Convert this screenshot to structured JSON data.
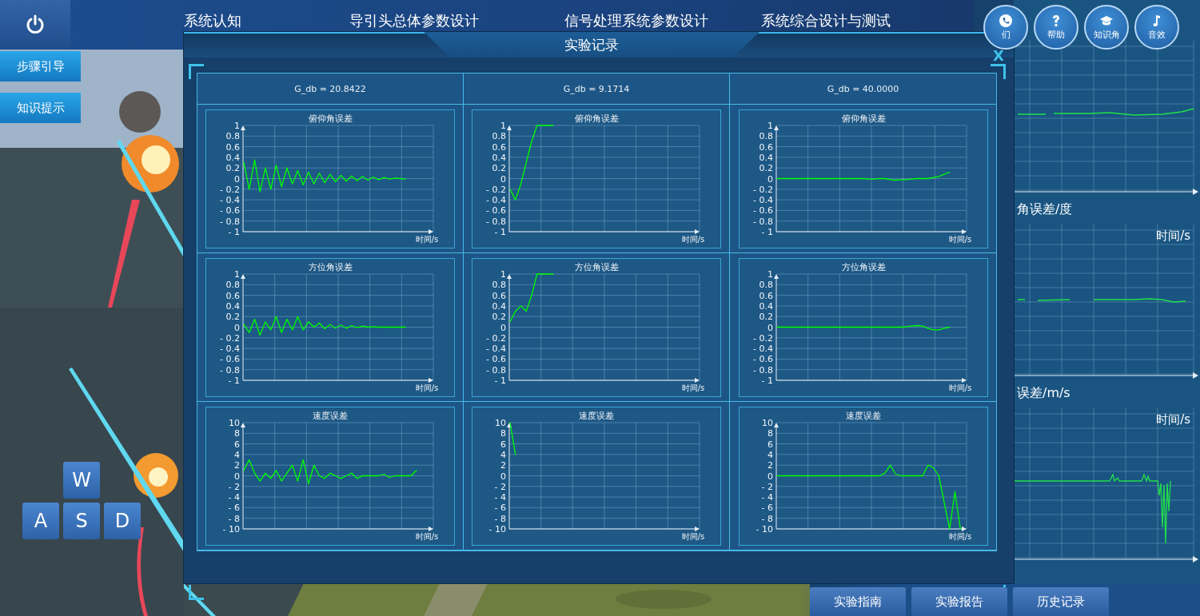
{
  "top_nav": {
    "tabs": [
      {
        "label": "系统认知"
      },
      {
        "label": "导引头总体参数设计"
      },
      {
        "label": "信号处理系统参数设计"
      },
      {
        "label": "系统综合设计与测试"
      }
    ]
  },
  "side_buttons": [
    "步骤引导",
    "知识提示"
  ],
  "keys": [
    "W",
    "A",
    "S",
    "D"
  ],
  "tool_buttons": [
    {
      "kind": "phone",
      "label": "们"
    },
    {
      "kind": "help",
      "label": "帮助"
    },
    {
      "kind": "cap",
      "label": "知识角"
    },
    {
      "kind": "note",
      "label": "音效"
    }
  ],
  "background_charts": [
    {
      "kind": "rise"
    },
    {
      "kind": "dip",
      "caption": "角误差/度",
      "xlabel": "时间/s"
    },
    {
      "kind": "spikes",
      "caption": "误差/m/s",
      "xlabel": "时间/s"
    }
  ],
  "dialog": {
    "title": "实验记录",
    "close": "X",
    "columns": [
      "G_db = 20.8422",
      "G_db = 9.1714",
      "G_db = 40.0000"
    ],
    "rows": [
      [
        {
          "chart_data": {
            "type": "line",
            "title": "俯仰角误差",
            "xlabel": "时间/s",
            "grid": true,
            "ylim": [
              -1,
              1
            ],
            "yticks": [
              1,
              {
                "value": 0.8,
                "label": "0.8"
              },
              {
                "value": 0.6,
                "label": "0.6"
              },
              {
                "value": 0.4,
                "label": "0.4"
              },
              {
                "value": 0.2,
                "label": "0.2"
              },
              0,
              {
                "value": -0.2,
                "label": "- 0.2"
              },
              {
                "value": -0.4,
                "label": "- 0.4"
              },
              {
                "value": -0.6,
                "label": "- 0.6"
              },
              {
                "value": -0.8,
                "label": "- 0.8"
              },
              {
                "value": -1,
                "label": "- 1"
              }
            ],
            "series": [
              {
                "color": "#00ff00",
                "values": [
                  0.3,
                  -0.2,
                  0.35,
                  -0.25,
                  0.2,
                  -0.2,
                  0.25,
                  -0.15,
                  0.2,
                  -0.1,
                  0.15,
                  -0.12,
                  0.12,
                  -0.1,
                  0.1,
                  -0.08,
                  0.08,
                  -0.06,
                  0.06,
                  -0.05,
                  0.05,
                  -0.04,
                  0.04,
                  -0.03,
                  0.03,
                  -0.02,
                  0.02,
                  -0.01,
                  0.01,
                  0,
                  -0.01,
                  null,
                  null,
                  null,
                  null,
                  null
                ]
              }
            ]
          }
        },
        {
          "chart_data": {
            "type": "line",
            "title": "俯仰角误差",
            "xlabel": "时间/s",
            "grid": true,
            "ylim": [
              -1,
              1
            ],
            "yticks": [
              1,
              {
                "value": 0.8,
                "label": "0.8"
              },
              {
                "value": 0.6,
                "label": "0.6"
              },
              {
                "value": 0.4,
                "label": "0.4"
              },
              {
                "value": 0.2,
                "label": "0.2"
              },
              0,
              {
                "value": -0.2,
                "label": "- 0.2"
              },
              {
                "value": -0.4,
                "label": "- 0.4"
              },
              {
                "value": -0.6,
                "label": "- 0.6"
              },
              {
                "value": -0.8,
                "label": "- 0.8"
              },
              {
                "value": -1,
                "label": "- 1"
              }
            ],
            "series": [
              {
                "color": "#00ff00",
                "values": [
                  -0.2,
                  -0.4,
                  -0.1,
                  0.3,
                  0.7,
                  1,
                  1,
                  1,
                  1,
                  null,
                  null,
                  null,
                  null,
                  null,
                  null,
                  null,
                  null,
                  null,
                  null,
                  null,
                  null,
                  null,
                  null,
                  null,
                  null,
                  null,
                  null,
                  null,
                  null,
                  null,
                  null,
                  null,
                  null,
                  null,
                  null,
                  null
                ]
              }
            ]
          }
        },
        {
          "chart_data": {
            "type": "line",
            "title": "俯仰角误差",
            "xlabel": "时间/s",
            "grid": true,
            "ylim": [
              -1,
              1
            ],
            "yticks": [
              1,
              {
                "value": 0.8,
                "label": "0.8"
              },
              {
                "value": 0.6,
                "label": "0.6"
              },
              {
                "value": 0.4,
                "label": "0.4"
              },
              {
                "value": 0.2,
                "label": "0.2"
              },
              0,
              {
                "value": -0.2,
                "label": "- 0.2"
              },
              {
                "value": -0.4,
                "label": "- 0.4"
              },
              {
                "value": -0.6,
                "label": "- 0.6"
              },
              {
                "value": -0.8,
                "label": "- 0.8"
              },
              {
                "value": -1,
                "label": "- 1"
              }
            ],
            "series": [
              {
                "color": "#00ff00",
                "values": [
                  0,
                  0,
                  0,
                  0,
                  0,
                  0,
                  0,
                  0,
                  0,
                  0,
                  0,
                  0,
                  0,
                  0,
                  0,
                  0,
                  0,
                  -0.01,
                  -0.01,
                  0,
                  0,
                  -0.02,
                  -0.03,
                  -0.02,
                  -0.02,
                  -0.01,
                  0,
                  0,
                  0,
                  0.02,
                  0.04,
                  0.08,
                  0.12,
                  null,
                  null,
                  null
                ]
              }
            ]
          }
        }
      ],
      [
        {
          "chart_data": {
            "type": "line",
            "title": "方位角误差",
            "xlabel": "时间/s",
            "grid": true,
            "ylim": [
              -1,
              1
            ],
            "yticks": [
              1,
              {
                "value": 0.8,
                "label": "0.8"
              },
              {
                "value": 0.6,
                "label": "0.6"
              },
              {
                "value": 0.4,
                "label": "0.4"
              },
              {
                "value": 0.2,
                "label": "0.2"
              },
              0,
              {
                "value": -0.2,
                "label": "- 0.2"
              },
              {
                "value": -0.4,
                "label": "- 0.4"
              },
              {
                "value": -0.6,
                "label": "- 0.6"
              },
              {
                "value": -0.8,
                "label": "- 0.8"
              },
              {
                "value": -1,
                "label": "- 1"
              }
            ],
            "series": [
              {
                "color": "#00ff00",
                "values": [
                  0.05,
                  -0.1,
                  0.15,
                  -0.15,
                  0.1,
                  -0.05,
                  0.2,
                  -0.1,
                  0.15,
                  -0.05,
                  0.2,
                  -0.05,
                  0.1,
                  0,
                  0.08,
                  -0.03,
                  0.05,
                  -0.02,
                  0.04,
                  -0.02,
                  0.03,
                  -0.01,
                  0.02,
                  0,
                  0.01,
                  0,
                  0,
                  0,
                  0,
                  0,
                  0,
                  null,
                  null,
                  null,
                  null,
                  null
                ]
              }
            ]
          }
        },
        {
          "chart_data": {
            "type": "line",
            "title": "方位角误差",
            "xlabel": "时间/s",
            "grid": true,
            "ylim": [
              -1,
              1
            ],
            "yticks": [
              1,
              {
                "value": 0.8,
                "label": "0.8"
              },
              {
                "value": 0.6,
                "label": "0.6"
              },
              {
                "value": 0.4,
                "label": "0.4"
              },
              {
                "value": 0.2,
                "label": "0.2"
              },
              0,
              {
                "value": -0.2,
                "label": "- 0.2"
              },
              {
                "value": -0.4,
                "label": "- 0.4"
              },
              {
                "value": -0.6,
                "label": "- 0.6"
              },
              {
                "value": -0.8,
                "label": "- 0.8"
              },
              {
                "value": -1,
                "label": "- 1"
              }
            ],
            "series": [
              {
                "color": "#00ff00",
                "values": [
                  0.1,
                  0.3,
                  0.4,
                  0.3,
                  0.6,
                  1,
                  1,
                  1,
                  1,
                  null,
                  null,
                  null,
                  null,
                  null,
                  null,
                  null,
                  null,
                  null,
                  null,
                  null,
                  null,
                  null,
                  null,
                  null,
                  null,
                  null,
                  null,
                  null,
                  null,
                  null,
                  null,
                  null,
                  null,
                  null,
                  null,
                  null
                ]
              }
            ]
          }
        },
        {
          "chart_data": {
            "type": "line",
            "title": "方位角误差",
            "xlabel": "时间/s",
            "grid": true,
            "ylim": [
              -1,
              1
            ],
            "yticks": [
              1,
              {
                "value": 0.8,
                "label": "0.8"
              },
              {
                "value": 0.6,
                "label": "0.6"
              },
              {
                "value": 0.4,
                "label": "0.4"
              },
              {
                "value": 0.2,
                "label": "0.2"
              },
              0,
              {
                "value": -0.2,
                "label": "- 0.2"
              },
              {
                "value": -0.4,
                "label": "- 0.4"
              },
              {
                "value": -0.6,
                "label": "- 0.6"
              },
              {
                "value": -0.8,
                "label": "- 0.8"
              },
              {
                "value": -1,
                "label": "- 1"
              }
            ],
            "series": [
              {
                "color": "#00ff00",
                "values": [
                  0,
                  0,
                  0,
                  0,
                  0,
                  0,
                  0,
                  0,
                  0,
                  0,
                  0,
                  0,
                  0,
                  0,
                  0,
                  0,
                  0,
                  0,
                  0,
                  0,
                  0,
                  0,
                  0,
                  0,
                  0.01,
                  0.02,
                  0.03,
                  0.02,
                  -0.02,
                  -0.05,
                  -0.05,
                  -0.02,
                  0,
                  null,
                  null,
                  null
                ]
              }
            ]
          }
        }
      ],
      [
        {
          "chart_data": {
            "type": "line",
            "title": "速度误差",
            "xlabel": "时间/s",
            "grid": true,
            "ylim": [
              -10,
              10
            ],
            "yticks": [
              10,
              8,
              6,
              4,
              2,
              0,
              {
                "value": -2,
                "label": "- 2"
              },
              {
                "value": -4,
                "label": "- 4"
              },
              {
                "value": -6,
                "label": "- 6"
              },
              {
                "value": -8,
                "label": "- 8"
              },
              {
                "value": -10,
                "label": "- 10"
              }
            ],
            "series": [
              {
                "color": "#00ff00",
                "values": [
                  1,
                  3,
                  0.5,
                  -1,
                  0.5,
                  -0.5,
                  1,
                  -1,
                  0.5,
                  2,
                  -1,
                  3,
                  -1.5,
                  2,
                  0,
                  -0.5,
                  0.5,
                  0,
                  -0.5,
                  0,
                  0.5,
                  -0.5,
                  0,
                  0,
                  0,
                  0,
                  0.3,
                  -0.3,
                  0,
                  0,
                  0,
                  0,
                  1,
                  null,
                  null,
                  null
                ]
              }
            ]
          }
        },
        {
          "chart_data": {
            "type": "line",
            "title": "速度误差",
            "xlabel": "时间/s",
            "grid": true,
            "ylim": [
              -10,
              10
            ],
            "yticks": [
              10,
              8,
              6,
              4,
              2,
              0,
              {
                "value": -2,
                "label": "- 2"
              },
              {
                "value": -4,
                "label": "- 4"
              },
              {
                "value": -6,
                "label": "- 6"
              },
              {
                "value": -8,
                "label": "- 8"
              },
              {
                "value": -10,
                "label": "- 10"
              }
            ],
            "series": [
              {
                "color": "#00ff00",
                "values": [
                  10,
                  4,
                  null,
                  null,
                  null,
                  null,
                  null,
                  null,
                  null,
                  null,
                  null,
                  null,
                  null,
                  null,
                  null,
                  null,
                  null,
                  null,
                  null,
                  null,
                  null,
                  null,
                  null,
                  null,
                  null,
                  null,
                  null,
                  null,
                  null,
                  null,
                  null,
                  null,
                  null,
                  null,
                  null,
                  null
                ]
              }
            ]
          }
        },
        {
          "chart_data": {
            "type": "line",
            "title": "速度误差",
            "xlabel": "时间/s",
            "grid": true,
            "ylim": [
              -10,
              10
            ],
            "yticks": [
              10,
              8,
              6,
              4,
              2,
              0,
              {
                "value": -2,
                "label": "- 2"
              },
              {
                "value": -4,
                "label": "- 4"
              },
              {
                "value": -6,
                "label": "- 6"
              },
              {
                "value": -8,
                "label": "- 8"
              },
              {
                "value": -10,
                "label": "- 10"
              }
            ],
            "series": [
              {
                "color": "#00ff00",
                "values": [
                  0,
                  0,
                  0,
                  0,
                  0,
                  0,
                  0,
                  0,
                  0,
                  0,
                  0,
                  0,
                  0,
                  0,
                  0,
                  0,
                  0,
                  0,
                  0,
                  0,
                  0.5,
                  2,
                  0.3,
                  0,
                  0,
                  0,
                  0,
                  0,
                  2,
                  1.5,
                  0,
                  -5,
                  -10,
                  -3,
                  -10,
                  null
                ]
              }
            ]
          }
        }
      ]
    ]
  },
  "bottom_buttons": [
    "实验指南",
    "实验报告",
    "历史记录"
  ]
}
